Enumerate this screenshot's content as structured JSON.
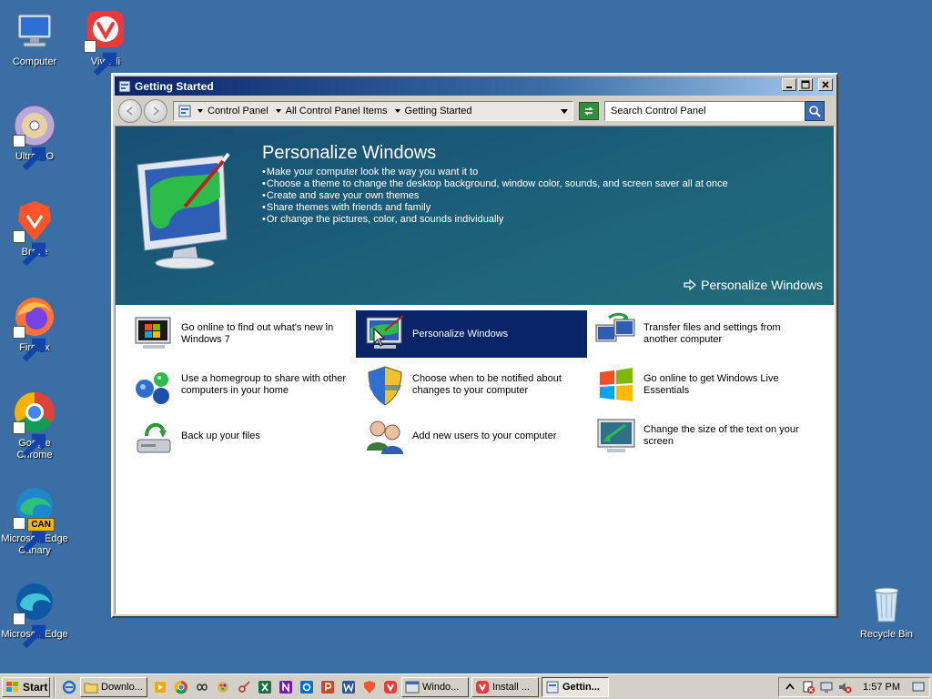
{
  "desktop": {
    "icons": [
      {
        "label": "Computer",
        "icon": "computer-icon"
      },
      {
        "label": "Vivaldi",
        "icon": "vivaldi-icon"
      },
      {
        "label": "UltraISO",
        "icon": "ultraiso-icon"
      },
      {
        "label": "Brave",
        "icon": "brave-icon"
      },
      {
        "label": "Firefox",
        "icon": "firefox-icon"
      },
      {
        "label": "Google Chrome",
        "icon": "chrome-icon"
      },
      {
        "label": "Microsoft Edge Canary",
        "icon": "edge-canary-icon",
        "badge": "CAN"
      },
      {
        "label": "Microsoft Edge",
        "icon": "edge-icon"
      },
      {
        "label": "Recycle Bin",
        "icon": "recycle-bin-icon"
      }
    ],
    "background_color": "#3a6ea5"
  },
  "window": {
    "title": "Getting Started",
    "breadcrumbs": [
      "Control Panel",
      "All Control Panel Items",
      "Getting Started"
    ],
    "search_placeholder": "Search Control Panel",
    "hero": {
      "title": "Personalize Windows",
      "bullets": [
        "Make your computer look the way you want it to",
        "Choose a theme to change the desktop background, window color, sounds, and screen saver all at once",
        "Create and save your own themes",
        "Share themes with friends and family",
        "Or change the pictures, color, and sounds individually"
      ],
      "link": "Personalize Windows"
    },
    "tasks": [
      {
        "label": "Go online to find out what's new in Windows 7",
        "icon": "whats-new-icon"
      },
      {
        "label": "Personalize Windows",
        "icon": "personalize-icon",
        "selected": true
      },
      {
        "label": "Transfer files and settings from another computer",
        "icon": "transfer-icon"
      },
      {
        "label": "Use a homegroup to share with other computers in your home",
        "icon": "homegroup-icon"
      },
      {
        "label": "Choose when to be notified about changes to your computer",
        "icon": "uac-shield-icon"
      },
      {
        "label": "Go online to get Windows Live Essentials",
        "icon": "windows-live-icon"
      },
      {
        "label": "Back up your files",
        "icon": "backup-icon"
      },
      {
        "label": "Add new users to your computer",
        "icon": "users-icon"
      },
      {
        "label": "Change the size of the text on your screen",
        "icon": "text-size-icon"
      }
    ],
    "selected_color": "#0a246a"
  },
  "taskbar": {
    "start_label": "Start",
    "quick_launch": [
      "ie-icon",
      "downloads-folder-icon"
    ],
    "buttons": [
      {
        "label": "Downlo...",
        "icon": "folder-icon",
        "active": false
      },
      {
        "label": "Windo...",
        "icon": "window-icon",
        "active": false
      },
      {
        "label": "Install ...",
        "icon": "vivaldi-icon",
        "active": false
      },
      {
        "label": "Gettin...",
        "icon": "control-panel-icon",
        "active": true
      }
    ],
    "pinned_apps": [
      "media-icon",
      "chrome-icon",
      "infinity-icon",
      "paint-icon",
      "sniping-icon",
      "excel-icon",
      "onenote-icon",
      "outlook-icon",
      "powerpoint-icon",
      "word-icon",
      "brave-icon",
      "vivaldi-icon"
    ],
    "clock": "1:57 PM"
  }
}
